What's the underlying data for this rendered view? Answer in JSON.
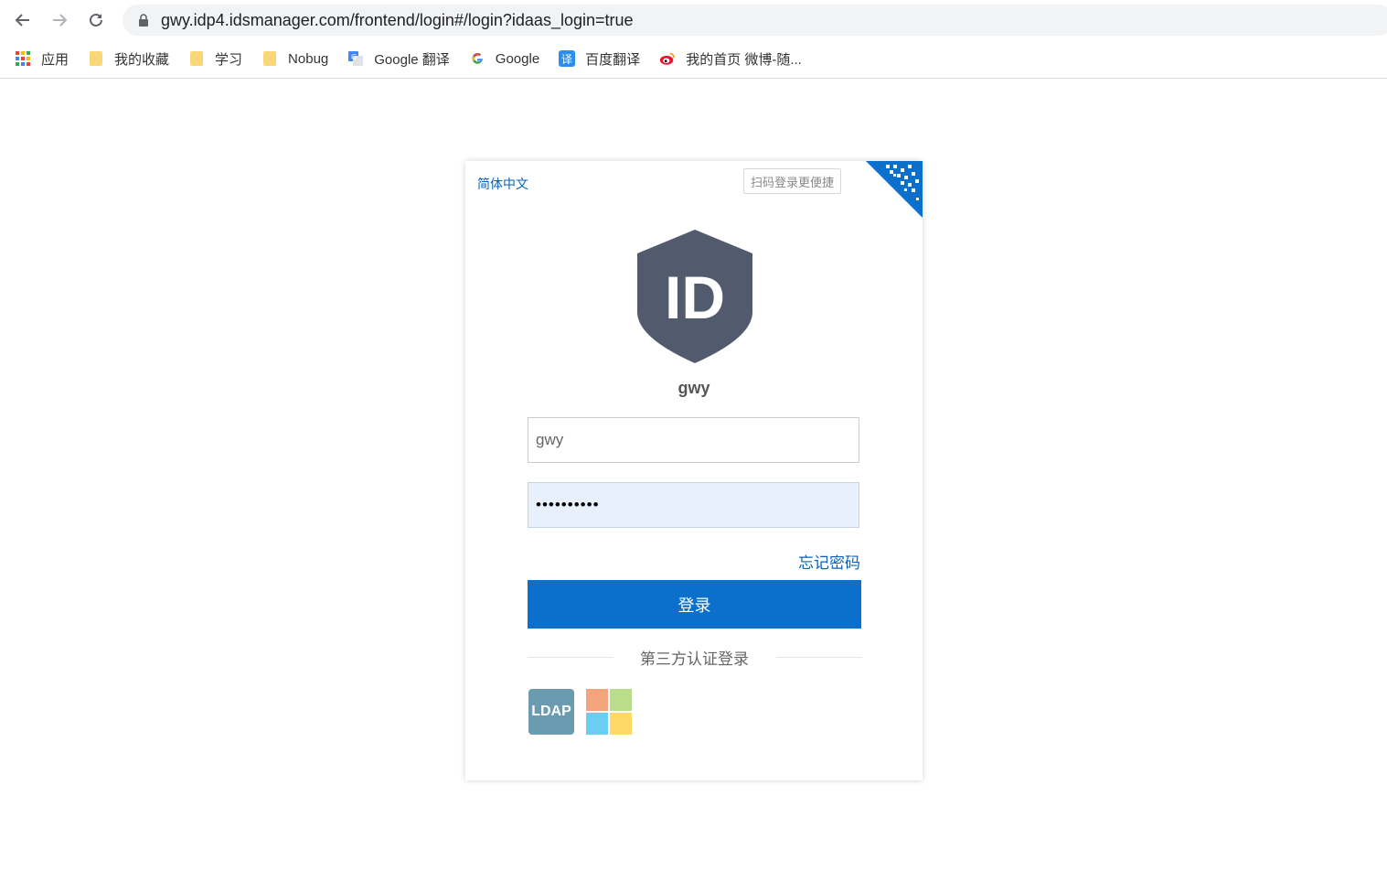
{
  "browser": {
    "url": "gwy.idp4.idsmanager.com/frontend/login#/login?idaas_login=true",
    "bookmarks": [
      {
        "label": "应用",
        "icon": "apps-grid-icon"
      },
      {
        "label": "我的收藏",
        "icon": "folder-icon"
      },
      {
        "label": "学习",
        "icon": "folder-icon"
      },
      {
        "label": "Nobug",
        "icon": "folder-icon"
      },
      {
        "label": "Google 翻译",
        "icon": "google-translate-icon"
      },
      {
        "label": "Google",
        "icon": "google-icon"
      },
      {
        "label": "百度翻译",
        "icon": "baidu-translate-icon"
      },
      {
        "label": "我的首页 微博-随...",
        "icon": "weibo-icon"
      }
    ]
  },
  "login": {
    "language": "简体中文",
    "qr_tip": "扫码登录更便捷",
    "logo_text": "ID",
    "tenant_name": "gwy",
    "username_value": "gwy",
    "password_value": "••••••••••",
    "forgot_label": "忘记密码",
    "submit_label": "登录",
    "third_party_label": "第三方认证登录",
    "ldap_label": "LDAP"
  },
  "colors": {
    "accent": "#0a70cc",
    "link": "#0a63b8",
    "logo_shield": "#525a6e",
    "ldap_bg": "#6a9bb0",
    "ms_tiles": [
      "#f4a47b",
      "#b9dd8a",
      "#6ccdf2",
      "#ffd966"
    ]
  }
}
